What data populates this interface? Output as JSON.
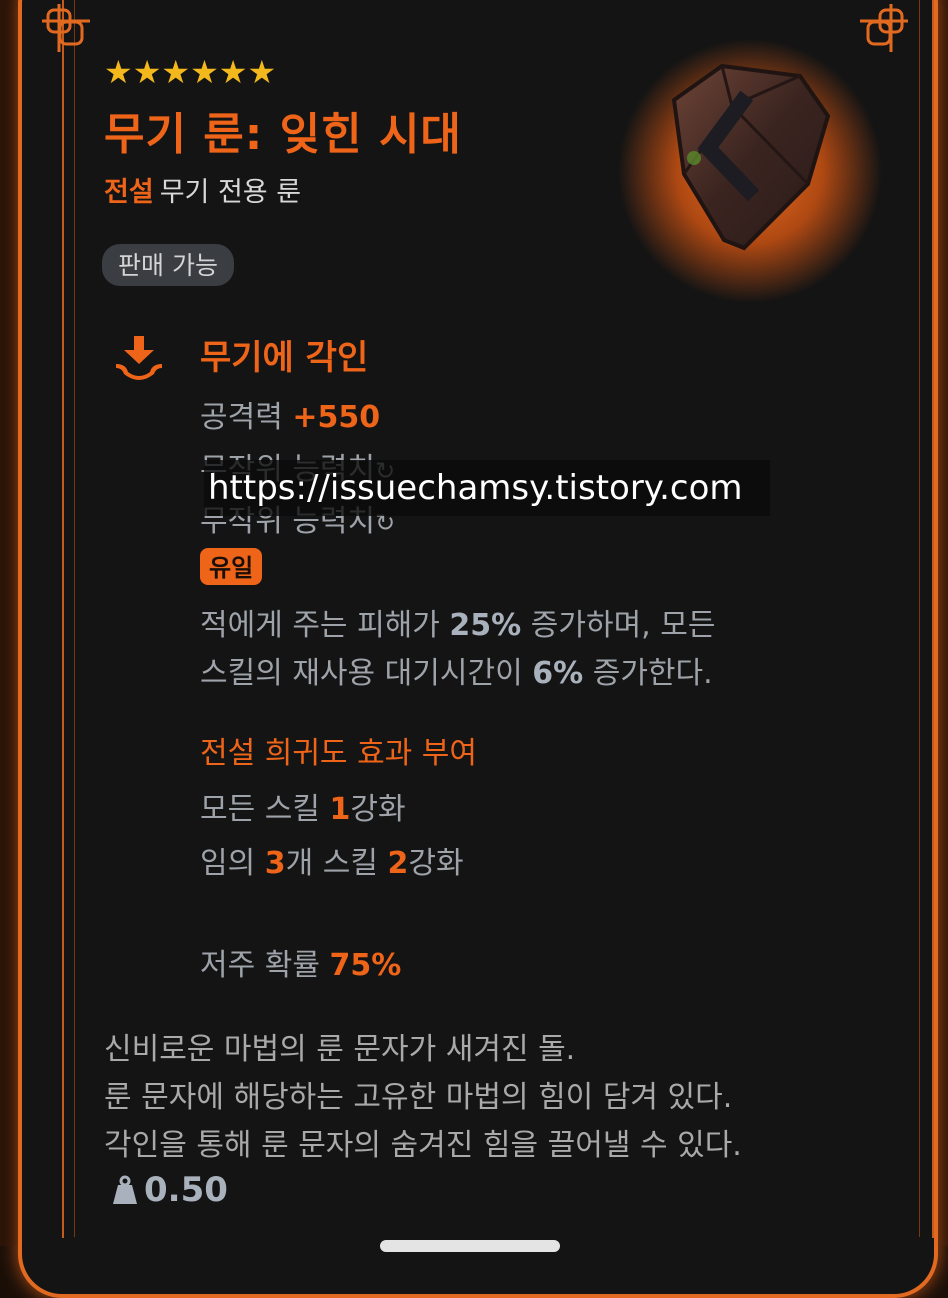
{
  "item": {
    "stars": "★★★★★★",
    "name": "무기 룬: 잊힌 시대",
    "grade": "전설",
    "type": "무기 전용 룬",
    "sell_status": "판매 가능"
  },
  "engrave": {
    "title": "무기에 각인",
    "attack_label": "공격력",
    "attack_value": "+550",
    "random_stat_1": "무작위 능력치",
    "random_stat_2": "무작위 능력치",
    "unique_badge": "유일",
    "effect_line1_a": "적에게 주는 피해가",
    "effect_line1_value": "25%",
    "effect_line1_b": "증가하며, 모든",
    "effect_line2_a": "스킬의 재사용 대기시간이",
    "effect_line2_value": "6%",
    "effect_line2_b": "증가한다."
  },
  "legend": {
    "title": "전설 희귀도 효과 부여",
    "line1_a": "모든 스킬",
    "line1_value": "1",
    "line1_b": "강화",
    "line2_a": "임의",
    "line2_value1": "3",
    "line2_b": "개 스킬",
    "line2_value2": "2",
    "line2_c": "강화"
  },
  "curse": {
    "label": "저주 확률",
    "value": "75%"
  },
  "description": [
    "신비로운 마법의 룬 문자가 새겨진 돌.",
    "룬 문자에 해당하는 고유한 마법의 힘이 담겨 있다.",
    "각인을 통해 룬 문자의 숨겨진 힘을 끌어낼 수 있다."
  ],
  "weight": "0.50",
  "watermark": "https://issuechamsy.tistory.com",
  "colors": {
    "accent": "#ee6418",
    "star": "#f2b81c",
    "background": "#141414"
  }
}
